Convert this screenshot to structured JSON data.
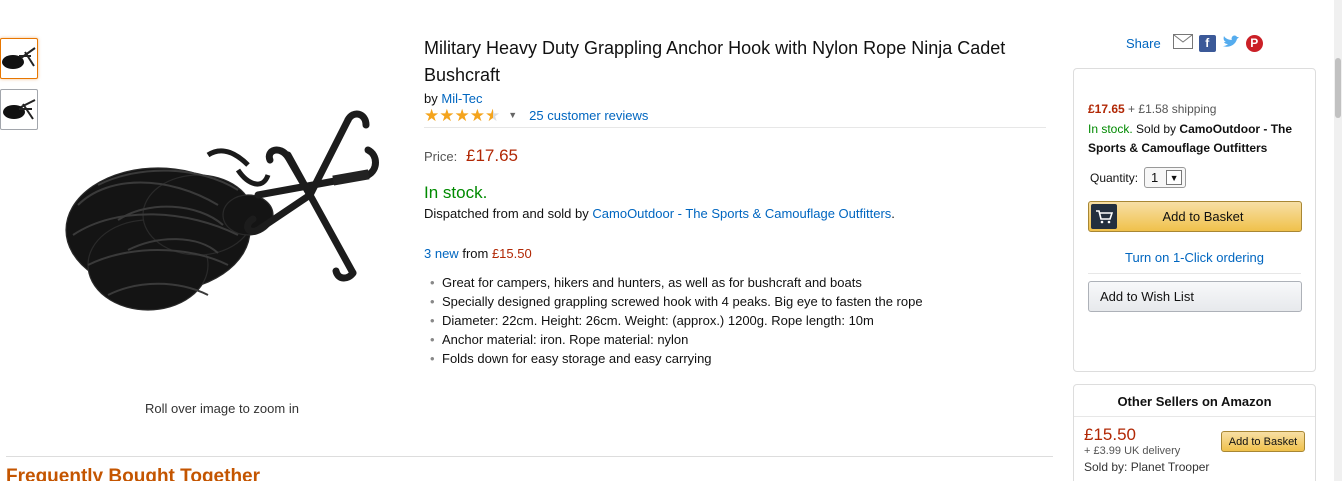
{
  "product": {
    "title": "Military Heavy Duty Grappling Anchor Hook with Nylon Rope Ninja Cadet Bushcraft",
    "by_prefix": "by",
    "brand": "Mil-Tec",
    "rating": 4.5,
    "reviews_link": "25 customer reviews",
    "price_label": "Price:",
    "price": "£17.65",
    "stock": "In stock.",
    "dispatch_prefix": "Dispatched from and sold by",
    "seller_link": "CamoOutdoor - The Sports & Camouflage Outfitters",
    "dispatch_suffix": ".",
    "new_link": "3 new",
    "new_from": "from",
    "new_price": "£15.50",
    "bullets": [
      "Great for campers, hikers and hunters, as well as for bushcraft and boats",
      "Specially designed grappling screwed hook with 4 peaks. Big eye to fasten the rope",
      "Diameter: 22cm. Height: 26cm. Weight: (approx.) 1200g. Rope length: 10m",
      "Anchor material: iron. Rope material: nylon",
      "Folds down for easy storage and easy carrying"
    ],
    "zoom_hint": "Roll over image to zoom in"
  },
  "section": {
    "frequently_bought": "Frequently Bought Together"
  },
  "share": {
    "label": "Share",
    "icons": [
      "email-icon",
      "facebook-icon",
      "twitter-icon",
      "pinterest-icon"
    ]
  },
  "buybox": {
    "price": "£17.65",
    "shipping": "+ £1.58 shipping",
    "stock": "In stock.",
    "sold_by_prefix": "Sold by",
    "seller": "CamoOutdoor - The Sports & Camouflage Outfitters",
    "quantity_label": "Quantity:",
    "quantity_value": "1",
    "add_to_basket": "Add to Basket",
    "one_click": "Turn on 1-Click ordering",
    "wish_list": "Add to Wish List"
  },
  "other_sellers": {
    "title": "Other Sellers on Amazon",
    "offers": [
      {
        "price": "£15.50",
        "shipping": "+ £3.99 UK delivery",
        "seller": "Sold by: Planet Trooper",
        "button": "Add to Basket"
      }
    ]
  },
  "colors": {
    "link": "#0066c0",
    "price": "#b12704",
    "in_stock": "#008a00",
    "button": "#f0c14b",
    "heading": "#c45500"
  }
}
